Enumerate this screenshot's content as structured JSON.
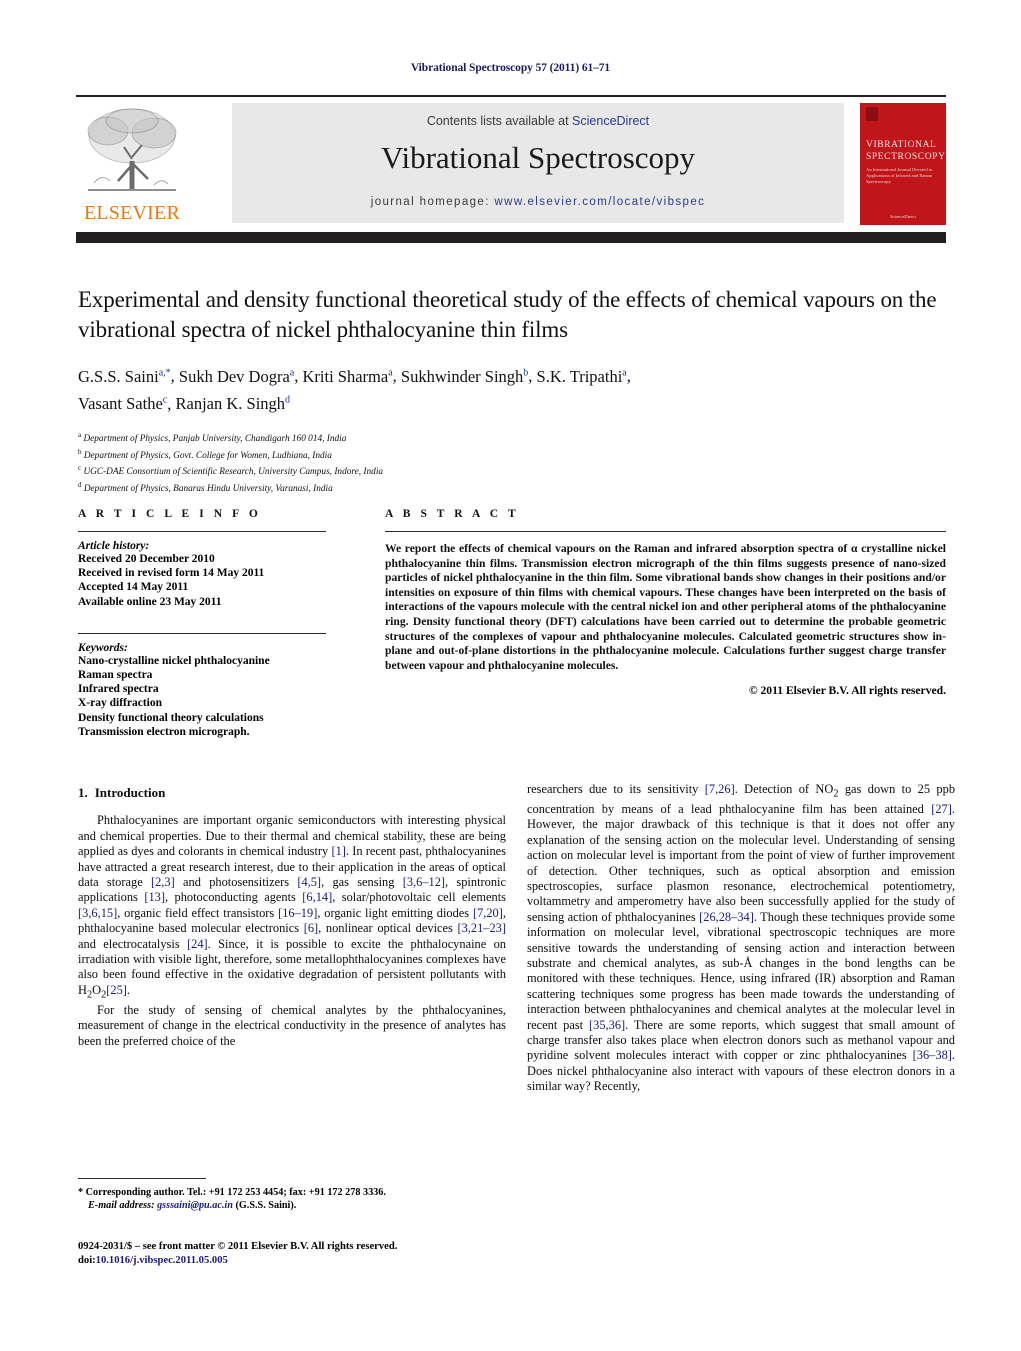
{
  "running_head": "Vibrational Spectroscopy 57 (2011) 61–71",
  "masthead": {
    "contents_prefix": "Contents lists available at ",
    "sciencedirect": "ScienceDirect",
    "journal_title": "Vibrational Spectroscopy",
    "homepage_prefix": "journal homepage: ",
    "homepage_url": "www.elsevier.com/locate/vibspec",
    "publisher": "ELSEVIER",
    "cover_title": "VIBRATIONAL SPECTROSCOPY",
    "cover_subtitle": "An International Journal Devoted to Applications of Infrared and Raman Spectroscopy",
    "cover_footer": "ScienceDirect",
    "accent_orange": "#e77817",
    "accent_red": "#c1151c",
    "link_blue": "#2b3a8f"
  },
  "title": "Experimental and density functional theoretical study of the effects of chemical vapours on the vibrational spectra of nickel phthalocyanine thin films",
  "authors": [
    {
      "name": "G.S.S. Saini",
      "marks": "a,*"
    },
    {
      "name": "Sukh Dev Dogra",
      "marks": "a"
    },
    {
      "name": "Kriti Sharma",
      "marks": "a"
    },
    {
      "name": "Sukhwinder Singh",
      "marks": "b"
    },
    {
      "name": "S.K. Tripathi",
      "marks": "a"
    },
    {
      "name": "Vasant Sathe",
      "marks": "c"
    },
    {
      "name": "Ranjan K. Singh",
      "marks": "d"
    }
  ],
  "affiliations": [
    {
      "mark": "a",
      "text": "Department of Physics, Panjab University, Chandigarh 160 014, India"
    },
    {
      "mark": "b",
      "text": "Department of Physics, Govt. College for Women, Ludhiana, India"
    },
    {
      "mark": "c",
      "text": "UGC-DAE Consortium of Scientific Research, University Campus, Indore, India"
    },
    {
      "mark": "d",
      "text": "Department of Physics, Banaras Hindu University, Varanasi, India"
    }
  ],
  "article_info": {
    "label": "A R T I C L E  I N F O",
    "history_label": "Article history:",
    "history": [
      "Received 20 December 2010",
      "Received in revised form 14 May 2011",
      "Accepted 14 May 2011",
      "Available online 23 May 2011"
    ],
    "keywords_label": "Keywords:",
    "keywords": [
      "Nano-crystalline nickel phthalocyanine",
      "Raman spectra",
      "Infrared spectra",
      "X-ray diffraction",
      "Density functional theory calculations",
      "Transmission electron micrograph."
    ]
  },
  "abstract": {
    "label": "A B S T R A C T",
    "text": "We report the effects of chemical vapours on the Raman and infrared absorption spectra of α crystalline nickel phthalocyanine thin films. Transmission electron micrograph of the thin films suggests presence of nano-sized particles of nickel phthalocyanine in the thin film. Some vibrational bands show changes in their positions and/or intensities on exposure of thin films with chemical vapours. These changes have been interpreted on the basis of interactions of the vapours molecule with the central nickel ion and other peripheral atoms of the phthalocyanine ring. Density functional theory (DFT) calculations have been carried out to determine the probable geometric structures of the complexes of vapour and phthalocyanine molecules. Calculated geometric structures show in-plane and out-of-plane distortions in the phthalocyanine molecule. Calculations further suggest charge transfer between vapour and phthalocyanine molecules.",
    "copyright": "© 2011 Elsevier B.V. All rights reserved."
  },
  "body": {
    "section_number": "1.",
    "section_title": "Introduction",
    "left_paragraph_1_a": "Phthalocyanines are important organic semiconductors with interesting physical and chemical properties. Due to their thermal and chemical stability, these are being applied as dyes and colorants in chemical industry ",
    "c1": "[1]",
    "left_paragraph_1_b": ". In recent past, phthalocyanines have attracted a great research interest, due to their application in the areas of optical data storage ",
    "c2": "[2,3]",
    "left_paragraph_1_c": " and photosensitizers ",
    "c3": "[4,5]",
    "left_paragraph_1_d": ", gas sensing ",
    "c4": "[3,6–12]",
    "left_paragraph_1_e": ", spintronic applications ",
    "c5": "[13]",
    "left_paragraph_1_f": ", photoconducting agents ",
    "c6": "[6,14]",
    "left_paragraph_1_g": ", solar/photovoltaic cell elements ",
    "c7": "[3,6,15]",
    "left_paragraph_1_h": ", organic field effect transistors ",
    "c8": "[16–19]",
    "left_paragraph_1_i": ", organic light emitting diodes ",
    "c9": "[7,20]",
    "left_paragraph_1_j": ", phthalocyanine based molecular electronics ",
    "c10": "[6]",
    "left_paragraph_1_k": ", nonlinear optical devices ",
    "c11": "[3,21–23]",
    "left_paragraph_1_l": " and electrocatalysis ",
    "c12": "[24]",
    "left_paragraph_1_m": ". Since, it is possible to excite the phthalocynaine on irradiation with visible light, therefore, some metallophthalocyanines complexes have also been found effective in the oxidative degradation of persistent pollutants with H",
    "sub2a": "2",
    "left_paragraph_1_n": "O",
    "sub2b": "2",
    "c13": "[25]",
    "left_paragraph_1_o": ".",
    "left_paragraph_2": "For the study of sensing of chemical analytes by the phthalocyanines, measurement of change in the electrical conductivity in the presence of analytes has been the preferred choice of the",
    "right_a": "researchers due to its sensitivity ",
    "rc1": "[7,26]",
    "right_b": ". Detection of NO",
    "rsub": "2",
    "right_c": " gas down to 25 ppb concentration by means of a lead phthalocyanine film has been attained ",
    "rc2": "[27]",
    "right_d": ". However, the major drawback of this technique is that it does not offer any explanation of the sensing action on the molecular level. Understanding of sensing action on molecular level is important from the point of view of further improvement of detection. Other techniques, such as optical absorption and emission spectroscopies, surface plasmon resonance, electrochemical potentiometry, voltammetry and amperometry have also been successfully applied for the study of sensing action of phthalocyanines ",
    "rc3": "[26,28–34]",
    "right_e": ". Though these techniques provide some information on molecular level, vibrational spectroscopic techniques are more sensitive towards the understanding of sensing action and interaction between substrate and chemical analytes, as sub-Å changes in the bond lengths can be monitored with these techniques. Hence, using infrared (IR) absorption and Raman scattering techniques some progress has been made towards the understanding of interaction between phthalocyanines and chemical analytes at the molecular level in recent past ",
    "rc4": "[35,36]",
    "right_f": ". There are some reports, which suggest that small amount of charge transfer also takes place when electron donors such as methanol vapour and pyridine solvent molecules interact with copper or zinc phthalocyanines ",
    "rc5": "[36–38]",
    "right_g": ". Does nickel phthalocyanine also interact with vapours of these electron donors in a similar way? Recently,"
  },
  "footnote": {
    "star": "*",
    "corresponding": " Corresponding author. Tel.: +91 172 253 4454; fax: +91 172 278 3336.",
    "email_label": "E-mail address:",
    "email": "gsssaini@pu.ac.in",
    "email_owner": "(G.S.S. Saini)."
  },
  "imprint": {
    "line1": "0924-2031/$ – see front matter © 2011 Elsevier B.V. All rights reserved.",
    "doi_label": "doi:",
    "doi_value": "10.1016/j.vibspec.2011.05.005"
  }
}
